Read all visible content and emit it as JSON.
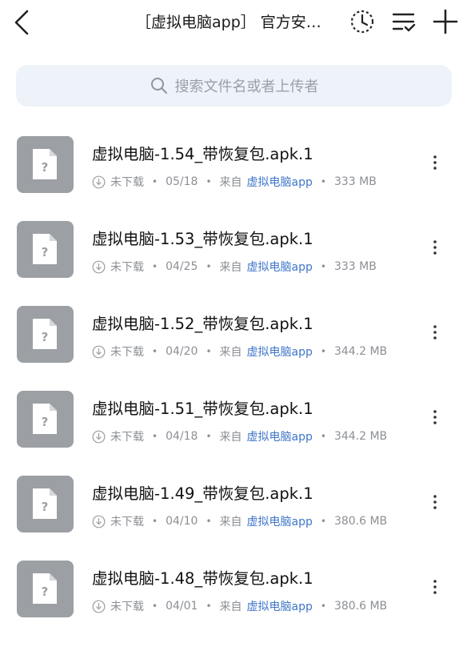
{
  "header": {
    "title": "［虚拟电脑app］ 官方安…",
    "icons": [
      "back-arrow-icon",
      "history-clock-icon",
      "sort-icon",
      "add-icon"
    ]
  },
  "search": {
    "placeholder": "搜索文件名或者上传者"
  },
  "colors": {
    "accent": "#3f76c9",
    "thumb": "#9ca0a4",
    "search_bg": "#eef3fa"
  },
  "files": [
    {
      "name": "虚拟电脑-1.54_带恢复包.apk.1",
      "status": "未下载",
      "date": "05/18",
      "from_label": "来自",
      "source": "虚拟电脑app",
      "size": "333 MB"
    },
    {
      "name": "虚拟电脑-1.53_带恢复包.apk.1",
      "status": "未下载",
      "date": "04/25",
      "from_label": "来自",
      "source": "虚拟电脑app",
      "size": "333 MB"
    },
    {
      "name": "虚拟电脑-1.52_带恢复包.apk.1",
      "status": "未下载",
      "date": "04/20",
      "from_label": "来自",
      "source": "虚拟电脑app",
      "size": "344.2 MB"
    },
    {
      "name": "虚拟电脑-1.51_带恢复包.apk.1",
      "status": "未下载",
      "date": "04/18",
      "from_label": "来自",
      "source": "虚拟电脑app",
      "size": "344.2 MB"
    },
    {
      "name": "虚拟电脑-1.49_带恢复包.apk.1",
      "status": "未下载",
      "date": "04/10",
      "from_label": "来自",
      "source": "虚拟电脑app",
      "size": "380.6 MB"
    },
    {
      "name": "虚拟电脑-1.48_带恢复包.apk.1",
      "status": "未下载",
      "date": "04/01",
      "from_label": "来自",
      "source": "虚拟电脑app",
      "size": "380.6 MB"
    }
  ]
}
